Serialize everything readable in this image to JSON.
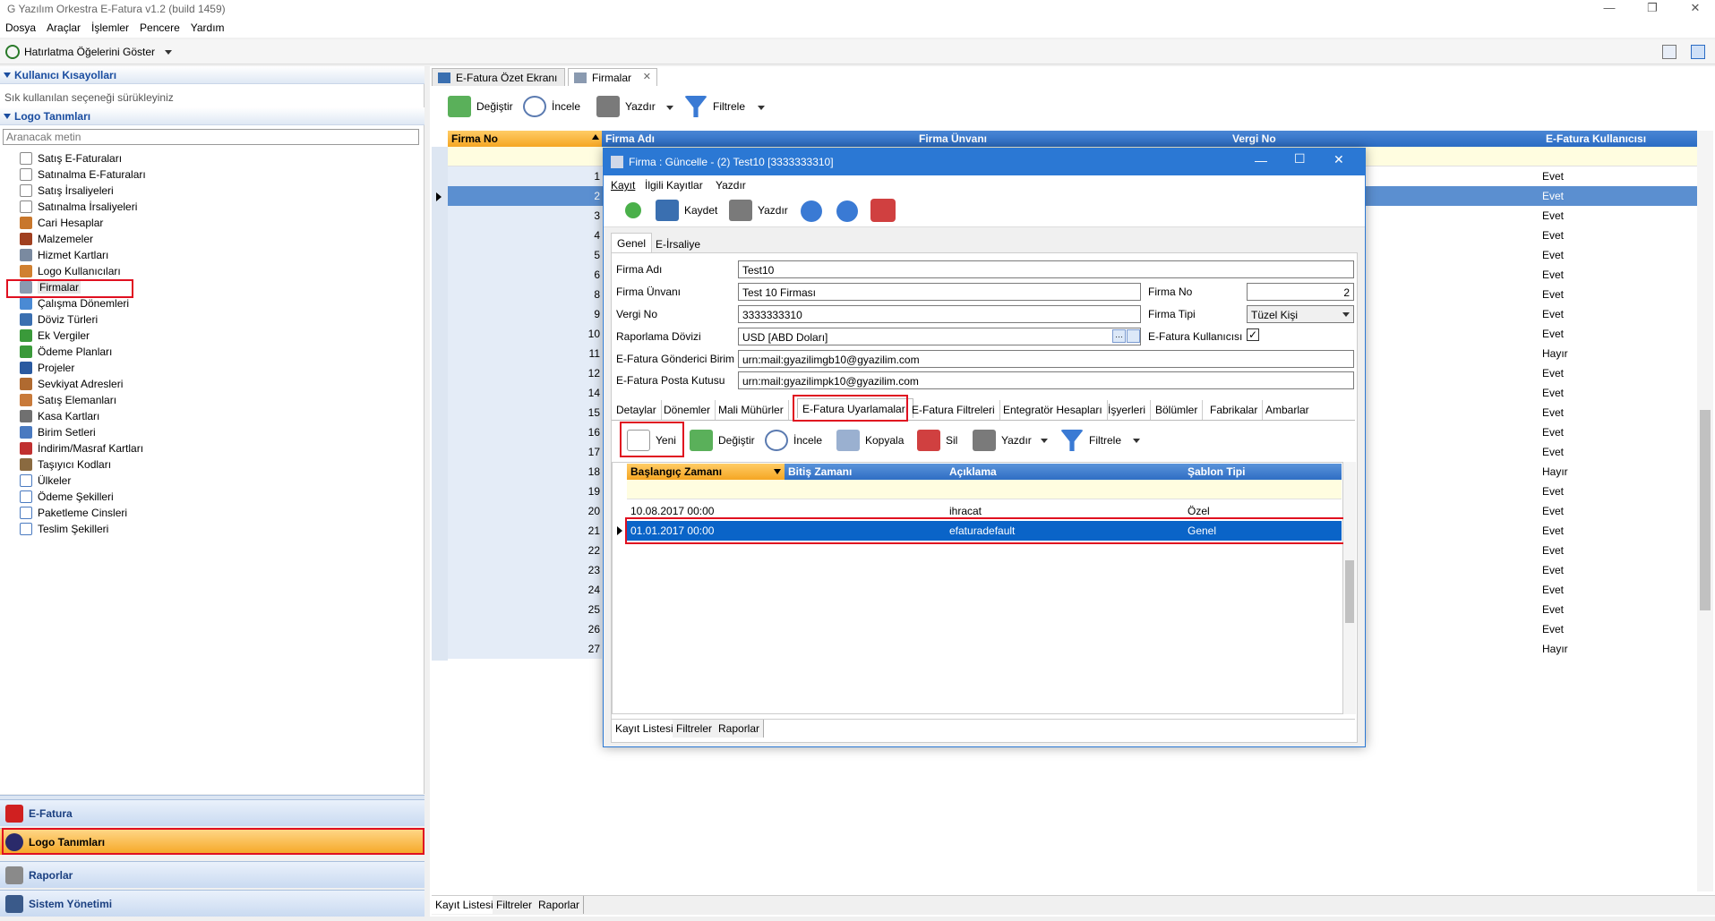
{
  "app": {
    "title": "G Yazılım Orkestra E-Fatura v1.2 (build 1459)"
  },
  "menu": [
    "Dosya",
    "Araçlar",
    "İşlemler",
    "Pencere",
    "Yardım"
  ],
  "toolbar": {
    "reminder": "Hatırlatma Öğelerini Göster"
  },
  "left": {
    "shortcuts_title": "Kullanıcı Kısayolları",
    "shortcuts_hint": "Sık kullanılan seçeneği sürükleyiniz",
    "logo_title": "Logo Tanımları",
    "search_placeholder": "Aranacak metin",
    "items": [
      "Satış E-Faturaları",
      "Satınalma E-Faturaları",
      "Satış İrsaliyeleri",
      "Satınalma İrsaliyeleri",
      "Cari Hesaplar",
      "Malzemeler",
      "Hizmet Kartları",
      "Logo Kullanıcıları",
      "Firmalar",
      "Çalışma Dönemleri",
      "Döviz Türleri",
      "Ek Vergiler",
      "Ödeme Planları",
      "Projeler",
      "Sevkiyat Adresleri",
      "Satış Elemanları",
      "Kasa Kartları",
      "Birim Setleri",
      "İndirim/Masraf Kartları",
      "Taşıyıcı Kodları",
      "Ülkeler",
      "Ödeme Şekilleri",
      "Paketleme Cinsleri",
      "Teslim Şekilleri"
    ],
    "nav": [
      "E-Fatura",
      "Logo Tanımları",
      "Raporlar",
      "Sistem Yönetimi"
    ]
  },
  "tabs": [
    "E-Fatura Özet Ekranı",
    "Firmalar"
  ],
  "main_toolbar": [
    "Değiştir",
    "İncele",
    "Yazdır",
    "Filtrele"
  ],
  "grid": {
    "headers": [
      "Firma No",
      "Firma Adı",
      "Firma Ünvanı",
      "Vergi No",
      "E-Fatura Kullanıcısı"
    ],
    "rows": [
      {
        "no": "1",
        "ef": "Evet"
      },
      {
        "no": "2",
        "ef": "Evet"
      },
      {
        "no": "3",
        "ef": "Evet"
      },
      {
        "no": "4",
        "ef": "Evet"
      },
      {
        "no": "5",
        "ef": "Evet"
      },
      {
        "no": "6",
        "ef": "Evet"
      },
      {
        "no": "8",
        "ef": "Evet"
      },
      {
        "no": "9",
        "ef": "Evet"
      },
      {
        "no": "10",
        "ef": "Evet"
      },
      {
        "no": "11",
        "ef": "Hayır"
      },
      {
        "no": "12",
        "ef": "Evet"
      },
      {
        "no": "14",
        "ef": "Evet"
      },
      {
        "no": "15",
        "ef": "Evet"
      },
      {
        "no": "16",
        "ef": "Evet"
      },
      {
        "no": "17",
        "ef": "Evet"
      },
      {
        "no": "18",
        "ef": "Hayır"
      },
      {
        "no": "19",
        "ef": "Evet"
      },
      {
        "no": "20",
        "ef": "Evet"
      },
      {
        "no": "21",
        "ef": "Evet"
      },
      {
        "no": "22",
        "ef": "Evet"
      },
      {
        "no": "23",
        "ef": "Evet"
      },
      {
        "no": "24",
        "ef": "Evet"
      },
      {
        "no": "25",
        "ef": "Evet"
      },
      {
        "no": "26",
        "ef": "Evet"
      },
      {
        "no": "27",
        "ef": "Hayır"
      }
    ]
  },
  "bottom_tabs": [
    "Kayıt Listesi",
    "Filtreler",
    "Raporlar"
  ],
  "dialog": {
    "title": "Firma : Güncelle - (2) Test10 [3333333310]",
    "menu": [
      "Kayıt",
      "İlgili Kayıtlar",
      "Yazdır"
    ],
    "toolbar": {
      "save": "Kaydet",
      "print": "Yazdır"
    },
    "tabs": [
      "Genel",
      "E-İrsaliye"
    ],
    "labels": {
      "firma_adi": "Firma Adı",
      "firma_unvani": "Firma Ünvanı",
      "vergi_no": "Vergi No",
      "raporlama": "Raporlama Dövizi",
      "gonderici": "E-Fatura Gönderici Birim",
      "posta": "E-Fatura Posta Kutusu",
      "firma_no": "Firma No",
      "firma_tipi": "Firma Tipi",
      "efatura_kullanici": "E-Fatura Kullanıcısı"
    },
    "values": {
      "firma_adi": "Test10",
      "firma_unvani": "Test 10 Firması",
      "vergi_no": "3333333310",
      "raporlama": "USD [ABD Doları]",
      "gonderici": "urn:mail:gyazilimgb10@gyazilim.com",
      "posta": "urn:mail:gyazilimpk10@gyazilim.com",
      "firma_no": "2",
      "firma_tipi": "Tüzel Kişi"
    },
    "subtabs": [
      "Detaylar",
      "Dönemler",
      "Mali Mühürler",
      "E-Fatura Uyarlamaları",
      "E-Fatura Filtreleri",
      "Entegratör Hesapları",
      "İşyerleri",
      "Bölümler",
      "Fabrikalar",
      "Ambarlar"
    ],
    "sub_toolbar": [
      "Yeni",
      "Değiştir",
      "İncele",
      "Kopyala",
      "Sil",
      "Yazdır",
      "Filtrele"
    ],
    "grid_headers": [
      "Başlangıç Zamanı",
      "Bitiş Zamanı",
      "Açıklama",
      "Şablon Tipi"
    ],
    "grid_rows": [
      {
        "start": "10.08.2017 00:00",
        "end": "",
        "desc": "ihracat",
        "tpl": "Özel"
      },
      {
        "start": "01.01.2017 00:00",
        "end": "",
        "desc": "efaturadefault",
        "tpl": "Genel"
      }
    ],
    "bottom_tabs": [
      "Kayıt Listesi",
      "Filtreler",
      "Raporlar"
    ]
  }
}
